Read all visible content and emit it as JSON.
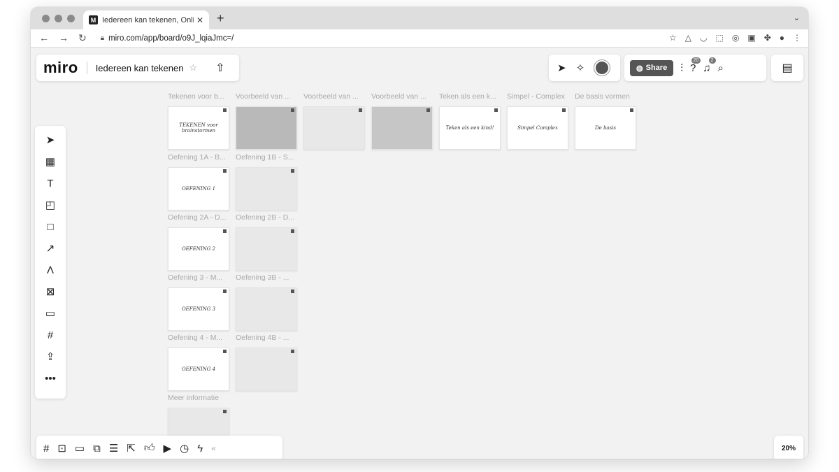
{
  "browser": {
    "tab_title": "Iedereen kan tekenen, Online W",
    "tab_favicon": "M",
    "url": "miro.com/app/board/o9J_lqiaJmc=/"
  },
  "header": {
    "logo": "miro",
    "board_name": "Iedereen kan tekenen",
    "share_label": "Share",
    "help_badge": "20",
    "notif_badge": "2"
  },
  "zoom": "20%",
  "frames_row1": [
    {
      "label": "Tekenen voor b...",
      "thumb": "TEKENEN voor brainstormen"
    },
    {
      "label": "Voorbeeld van ...",
      "thumb": ""
    },
    {
      "label": "Voorbeeld van ...",
      "thumb": ""
    },
    {
      "label": "Voorbeeld van ...",
      "thumb": ""
    },
    {
      "label": "Teken als een k...",
      "thumb": "Teken als een kind!"
    },
    {
      "label": "Simpel - Complex",
      "thumb": "Simpel   Complex"
    },
    {
      "label": "De basis vormen",
      "thumb": "De basis"
    }
  ],
  "frames_grid": [
    [
      {
        "label": "Oefening 1A - B...",
        "thumb": "OEFENING 1"
      },
      {
        "label": "Oefening 1B - S...",
        "thumb": ""
      }
    ],
    [
      {
        "label": "Oefening 2A - D...",
        "thumb": "OEFENING 2"
      },
      {
        "label": "Oefening 2B - D...",
        "thumb": ""
      }
    ],
    [
      {
        "label": "Oefening 3 - M...",
        "thumb": "OEFENING 3"
      },
      {
        "label": "Oefening 3B - ...",
        "thumb": ""
      }
    ],
    [
      {
        "label": "Oefening 4 - M...",
        "thumb": "OEFENING 4"
      },
      {
        "label": "Oefening 4B - ...",
        "thumb": ""
      }
    ],
    [
      {
        "label": "Meer informatie",
        "thumb": ""
      }
    ]
  ]
}
